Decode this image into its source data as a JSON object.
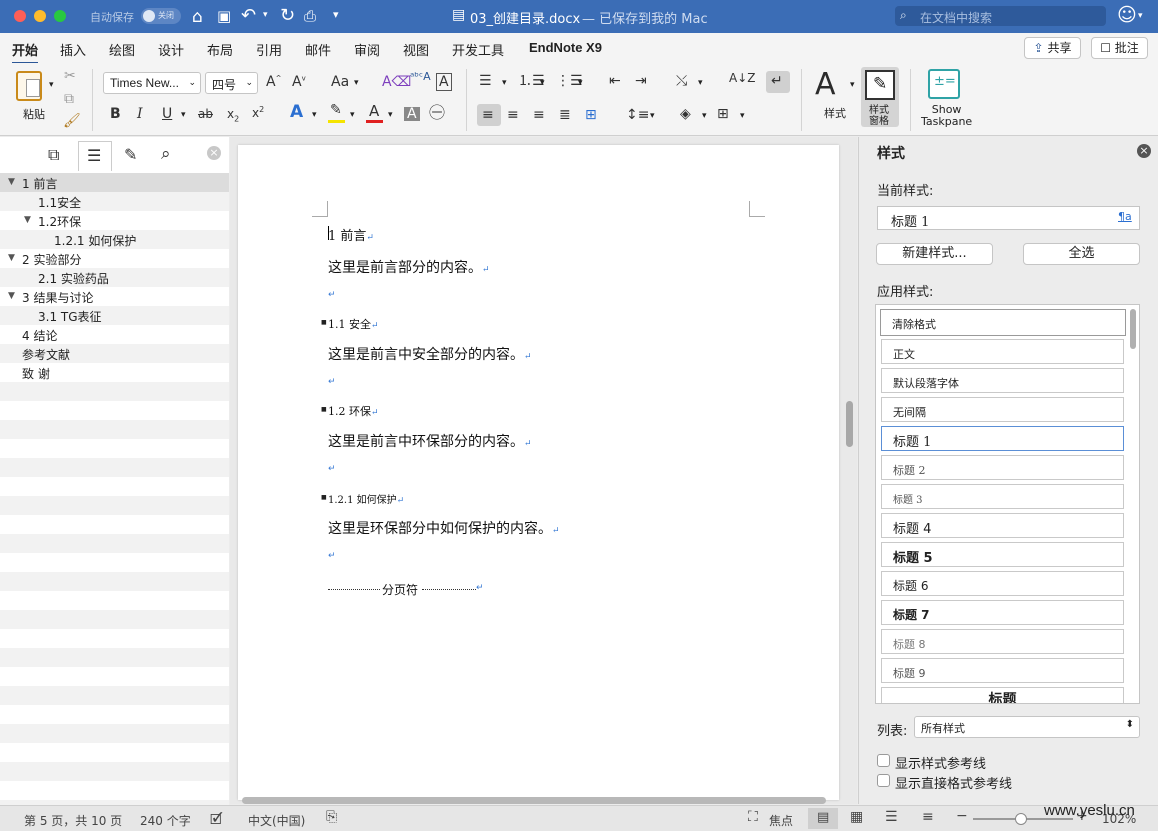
{
  "titlebar": {
    "autosave_label": "自动保存",
    "autosave_state": "关闭",
    "doc_title": "03_创建目录.docx",
    "save_status": "— 已保存到我的 Mac",
    "search_placeholder": "在文档中搜索"
  },
  "ribbon_tabs": [
    "开始",
    "插入",
    "绘图",
    "设计",
    "布局",
    "引用",
    "邮件",
    "审阅",
    "视图",
    "开发工具",
    "EndNote X9"
  ],
  "ribbon_actions": {
    "share": "共享",
    "comment": "批注"
  },
  "ribbon": {
    "paste_label": "粘贴",
    "font_name": "Times New...",
    "font_size": "四号",
    "styles_label": "样式",
    "styles_pane_label": "样式\n窗格",
    "show_taskpane_label": "Show\nTaskpane",
    "font_color": "#e02020",
    "highlight_color": "#f5e400"
  },
  "nav": {
    "items": [
      "1 前言",
      "1.1安全",
      "1.2环保",
      "1.2.1 如何保护",
      "2 实验部分",
      "2.1 实验药品",
      "3 结果与讨论",
      "3.1 TG表征",
      "4 结论",
      "参考文献",
      "致 谢"
    ]
  },
  "document": {
    "lines": [
      "1  前言",
      "这里是前言部分的内容。",
      "",
      "1.1 安全",
      "这里是前言中安全部分的内容。",
      "",
      "1.2 环保",
      "这里是前言中环保部分的内容。",
      "",
      "1.2.1  如何保护",
      "这里是环保部分中如何保护的内容。",
      "",
      "分页符"
    ]
  },
  "styles_pane": {
    "title": "样式",
    "current_style_label": "当前样式:",
    "current_style": "标题 1",
    "new_style_button": "新建样式...",
    "select_all_button": "全选",
    "apply_style_label": "应用样式:",
    "styles": [
      "清除格式",
      "正文",
      "默认段落字体",
      "无间隔",
      "标题 1",
      "标题 2",
      "标题 3",
      "标题 4",
      "标题 5",
      "标题 6",
      "标题 7",
      "标题 8",
      "标题 9",
      "标题"
    ],
    "list_label": "列表:",
    "list_value": "所有样式",
    "show_style_guides": "显示样式参考线",
    "show_direct_guides": "显示直接格式参考线"
  },
  "status": {
    "page": "第 5 页，共 10 页",
    "words": "240 个字",
    "language": "中文(中国)",
    "focus": "焦点",
    "zoom": "102%",
    "watermark": "www.yeslu.cn"
  }
}
